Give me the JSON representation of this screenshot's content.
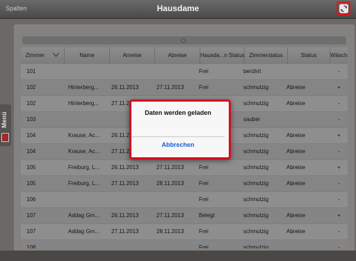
{
  "topbar": {
    "left_label": "Spalten",
    "title": "Hausdame",
    "refresh_icon": "refresh-icon"
  },
  "sidebar": {
    "label": "Menü"
  },
  "search": {
    "icon": "search-icon"
  },
  "table": {
    "columns": [
      "Zimmer",
      "Name",
      "Anreise",
      "Abreise",
      "Hausda...n Status",
      "Zimmerstatus",
      "Status",
      "Wäsche"
    ],
    "rows": [
      [
        "101",
        "",
        "",
        "",
        "Frei",
        "berührt",
        "",
        "-"
      ],
      [
        "102",
        "Hinterberg...",
        "26.11.2013",
        "27.11.2013",
        "Frei",
        "schmutzig",
        "Abreise",
        "+"
      ],
      [
        "102",
        "Hinterberg...",
        "27.11.2013",
        "",
        "",
        "schmutzig",
        "Abreise",
        "-"
      ],
      [
        "103",
        "",
        "",
        "",
        "",
        "sauber",
        "",
        "-"
      ],
      [
        "104",
        "Krause, Ac...",
        "26.11.2013",
        "",
        "",
        "schmutzig",
        "Abreise",
        "+"
      ],
      [
        "104",
        "Krause, Ac...",
        "27.11.2013",
        "",
        "",
        "schmutzig",
        "Abreise",
        "-"
      ],
      [
        "105",
        "Freiburg, L...",
        "26.11.2013",
        "27.11.2013",
        "Frei",
        "schmutzig",
        "Abreise",
        "+"
      ],
      [
        "105",
        "Freiburg, L...",
        "27.11.2013",
        "28.11.2013",
        "Frei",
        "schmutzig",
        "Abreise",
        "-"
      ],
      [
        "106",
        "",
        "",
        "",
        "Frei",
        "schmutzig",
        "",
        "-"
      ],
      [
        "107",
        "Addag Gm...",
        "26.11.2013",
        "27.11.2013",
        "Belegt",
        "schmutzig",
        "Abreise",
        "+"
      ],
      [
        "107",
        "Addag Gm...",
        "27.11.2013",
        "28.11.2013",
        "Frei",
        "schmutzig",
        "Abreise",
        "-"
      ],
      [
        "108",
        "",
        "",
        "",
        "Frei",
        "schmutzig",
        "",
        "-"
      ]
    ]
  },
  "dialog": {
    "title": "Daten werden geladen",
    "cancel_label": "Abbrechen"
  }
}
